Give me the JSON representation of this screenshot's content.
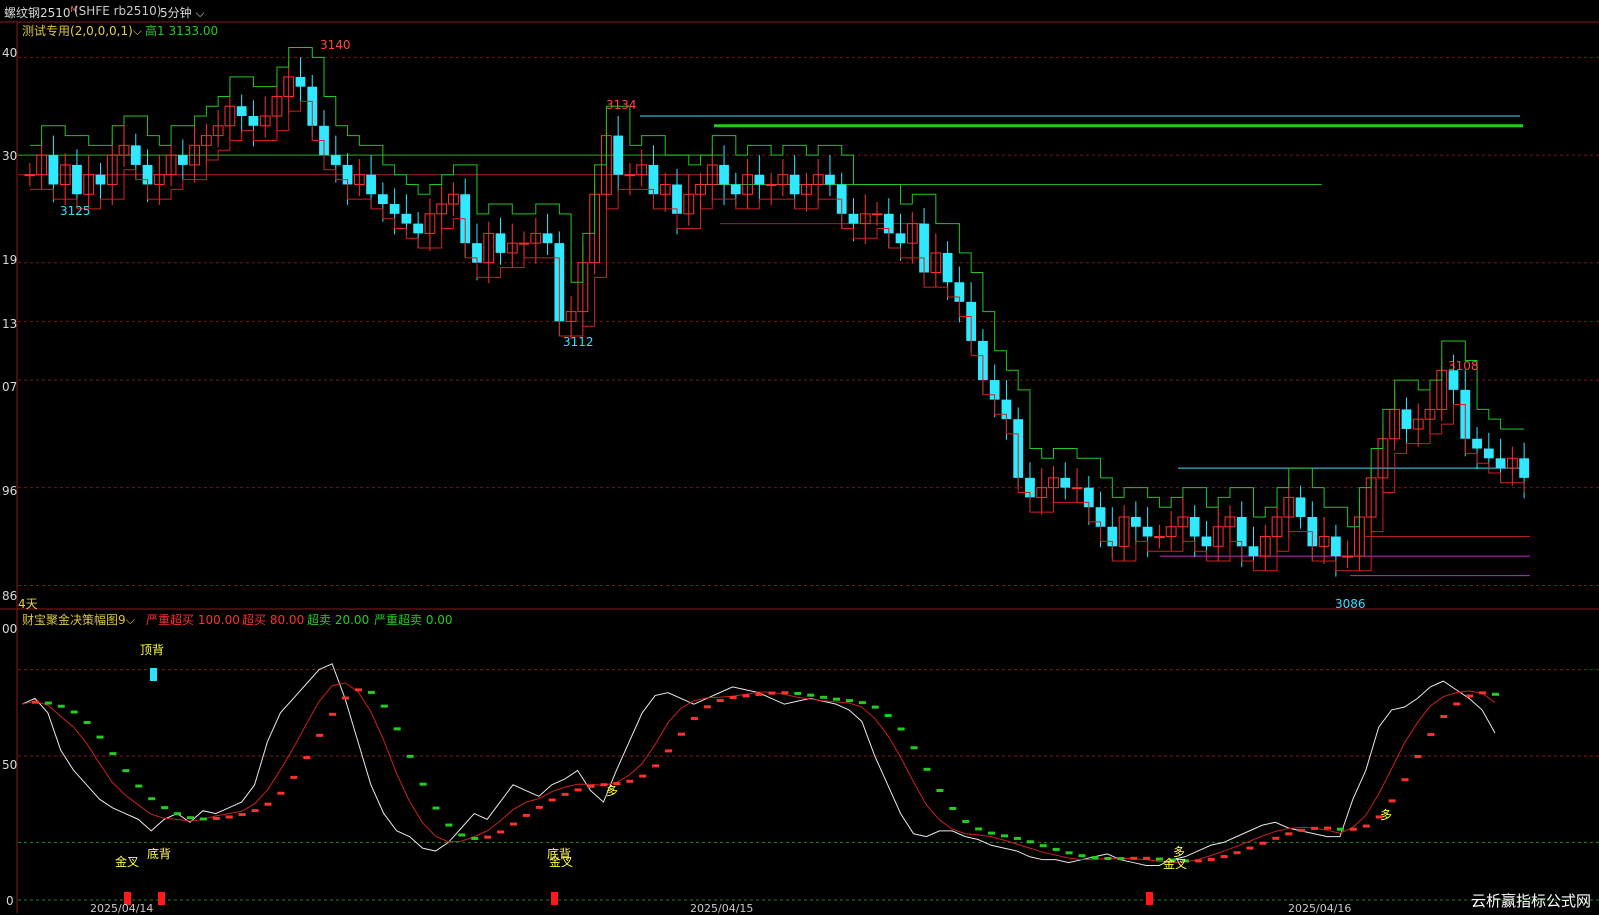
{
  "header": {
    "symbol": "螺纹钢2510",
    "symbol_sup": "M",
    "code": "(SHFE rb2510)",
    "period": "5分钟",
    "period_arrow": "⌵"
  },
  "main_panel": {
    "indicator_name": "测试专用",
    "indicator_params": "(2,0,0,0,1)",
    "indicator_arrow": "⌵",
    "high_label": "高1",
    "high_value": "3133.00",
    "span_label": "4天",
    "y_ticks": [
      "40",
      "30",
      "19",
      "13",
      "07",
      "96",
      "86"
    ],
    "annotations": [
      {
        "text": "3140",
        "color": "#ff4444"
      },
      {
        "text": "3125",
        "color": "#30e0ff"
      },
      {
        "text": "3134",
        "color": "#ff4444"
      },
      {
        "text": "3112",
        "color": "#30e0ff"
      },
      {
        "text": "3108",
        "color": "#ff4444"
      },
      {
        "text": "3086",
        "color": "#30e0ff"
      }
    ]
  },
  "sub_panel": {
    "indicator_name": "财宝聚金决策幅图9",
    "indicator_arrow": "⌵",
    "legend": [
      {
        "label": "严重超买",
        "value": "100.00",
        "color": "#ff3030"
      },
      {
        "label": "超买",
        "value": "80.00",
        "color": "#ff3030"
      },
      {
        "label": "超卖",
        "value": "20.00",
        "color": "#22cc22"
      },
      {
        "label": "严重超卖",
        "value": "0.00",
        "color": "#22cc22"
      }
    ],
    "y_ticks": [
      "00",
      "50",
      "0"
    ],
    "signals": [
      {
        "text": "顶背"
      },
      {
        "text": "金叉"
      },
      {
        "text": "底背"
      },
      {
        "text": "底背"
      },
      {
        "text": "金叉"
      },
      {
        "text": "多"
      },
      {
        "text": "多"
      },
      {
        "text": "金叉"
      },
      {
        "text": "多"
      }
    ]
  },
  "x_ticks": [
    "2025/04/14",
    "2025/04/15",
    "2025/04/16"
  ],
  "watermark": "云析赢指标公式网",
  "chart_data": {
    "type": "candlestick",
    "title": "螺纹钢2510 (SHFE rb2510) 5分钟",
    "y_range": [
      3084,
      3143
    ],
    "colors": {
      "up": "#ff3030",
      "down": "#30e8ff",
      "ma_green": "#22c522",
      "ma_red": "#cc2222"
    },
    "price_levels": [
      {
        "value": 3134,
        "color": "#30e0ff"
      },
      {
        "value": 3133,
        "color": "#22cc22"
      },
      {
        "value": 3130,
        "color": "#22aa22"
      },
      {
        "value": 3127,
        "color": "#22aa22"
      },
      {
        "value": 3128,
        "color": "#aa2222"
      },
      {
        "value": 3123,
        "color": "#aa2222"
      },
      {
        "value": 3098,
        "color": "#30e0ff"
      },
      {
        "value": 3091,
        "color": "#aa2222"
      },
      {
        "value": 3089,
        "color": "#cc22cc"
      },
      {
        "value": 3087,
        "color": "#cc22cc"
      }
    ],
    "close_series": [
      3128,
      3130,
      3127,
      3129,
      3126,
      3128,
      3127,
      3130,
      3131,
      3129,
      3127,
      3128,
      3130,
      3129,
      3131,
      3132,
      3133,
      3135,
      3134,
      3133,
      3134,
      3136,
      3138,
      3137,
      3133,
      3130,
      3129,
      3127,
      3128,
      3126,
      3125,
      3124,
      3123,
      3122,
      3124,
      3125,
      3126,
      3121,
      3119,
      3122,
      3120,
      3121,
      3121,
      3122,
      3121,
      3113,
      3114,
      3119,
      3126,
      3132,
      3128,
      3128,
      3129,
      3126,
      3127,
      3124,
      3126,
      3127,
      3129,
      3127,
      3126,
      3128,
      3127,
      3127,
      3128,
      3126,
      3127,
      3128,
      3127,
      3124,
      3123,
      3124,
      3124,
      3122,
      3121,
      3123,
      3118,
      3120,
      3117,
      3115,
      3111,
      3107,
      3105,
      3103,
      3097,
      3095,
      3096,
      3097,
      3096,
      3096,
      3094,
      3092,
      3090,
      3093,
      3092,
      3091,
      3091,
      3092,
      3093,
      3091,
      3090,
      3092,
      3093,
      3090,
      3089,
      3091,
      3093,
      3095,
      3093,
      3090,
      3091,
      3089,
      3089,
      3093,
      3097,
      3101,
      3104,
      3102,
      3103,
      3104,
      3108,
      3106,
      3101,
      3100,
      3099,
      3098,
      3099,
      3097
    ],
    "oscillator": {
      "y_range": [
        0,
        100
      ],
      "overbought": 80,
      "oversold": 20,
      "white": [
        68,
        70,
        65,
        52,
        45,
        40,
        35,
        32,
        30,
        28,
        24,
        28,
        30,
        27,
        31,
        30,
        32,
        34,
        40,
        55,
        65,
        70,
        75,
        80,
        82,
        70,
        55,
        40,
        30,
        24,
        22,
        18,
        17,
        20,
        25,
        30,
        28,
        34,
        40,
        38,
        36,
        40,
        42,
        45,
        38,
        34,
        45,
        55,
        65,
        71,
        72,
        70,
        68,
        70,
        72,
        74,
        73,
        72,
        70,
        68,
        69,
        70,
        69,
        68,
        66,
        62,
        50,
        40,
        30,
        23,
        22,
        24,
        24,
        22,
        21,
        19,
        18,
        17,
        15,
        14,
        14,
        13,
        14,
        15,
        16,
        14,
        13,
        12,
        12,
        14,
        15,
        17,
        19,
        20,
        22,
        24,
        26,
        27,
        25,
        24,
        23,
        22,
        22,
        35,
        45,
        60,
        66,
        67,
        70,
        74,
        76,
        73,
        70,
        66,
        58
      ]
    },
    "signal_markers": [
      "顶背",
      "金叉",
      "底背",
      "底背",
      "金叉",
      "多",
      "多",
      "金叉",
      "多"
    ]
  }
}
